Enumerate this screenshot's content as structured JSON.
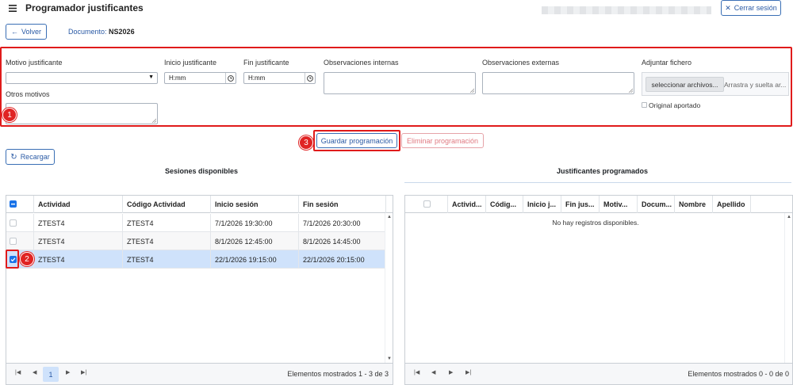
{
  "header": {
    "title": "Programador justificantes",
    "logout_label": "Cerrar sesión",
    "back_label": "Volver",
    "document_label": "Documento:",
    "document_value": "NS2026"
  },
  "form": {
    "motivo_label": "Motivo justificante",
    "inicio_label": "Inicio justificante",
    "inicio_placeholder": "H:mm",
    "fin_label": "Fin justificante",
    "fin_placeholder": "H:mm",
    "obs_internas_label": "Observaciones internas",
    "obs_externas_label": "Observaciones externas",
    "adjuntar_label": "Adjuntar fichero",
    "select_file_label": "seleccionar archivos...",
    "drop_hint": "Arrastra y suelta ar...",
    "original_label": "Original aportado",
    "otros_label": "Otros motivos"
  },
  "actions": {
    "guardar_label": "Guardar programación",
    "eliminar_label": "Eliminar programación",
    "recargar_label": "Recargar"
  },
  "sesiones": {
    "title": "Sesiones disponibles",
    "columns": [
      "Actividad",
      "Código Actividad",
      "Inicio sesión",
      "Fin sesión"
    ],
    "rows": [
      {
        "actividad": "ZTEST4",
        "codigo": "ZTEST4",
        "inicio": "7/1/2026 19:30:00",
        "fin": "7/1/2026 20:30:00",
        "checked": false
      },
      {
        "actividad": "ZTEST4",
        "codigo": "ZTEST4",
        "inicio": "8/1/2026 12:45:00",
        "fin": "8/1/2026 14:45:00",
        "checked": false
      },
      {
        "actividad": "ZTEST4",
        "codigo": "ZTEST4",
        "inicio": "22/1/2026 19:15:00",
        "fin": "22/1/2026 20:15:00",
        "checked": true
      }
    ],
    "page": "1",
    "footer": "Elementos mostrados 1 - 3 de 3"
  },
  "justificantes": {
    "title": "Justificantes programados",
    "columns": [
      "Activid...",
      "Códig...",
      "Inicio j...",
      "Fin jus...",
      "Motiv...",
      "Docum...",
      "Nombre",
      "Apellido"
    ],
    "empty": "No hay registros disponibles.",
    "footer": "Elementos mostrados 0 - 0 de 0"
  },
  "annotations": [
    "1",
    "2",
    "3"
  ],
  "colors": {
    "accent": "#1a73e8",
    "annotation": "#e02323",
    "selected_row": "#cfe2fb"
  }
}
